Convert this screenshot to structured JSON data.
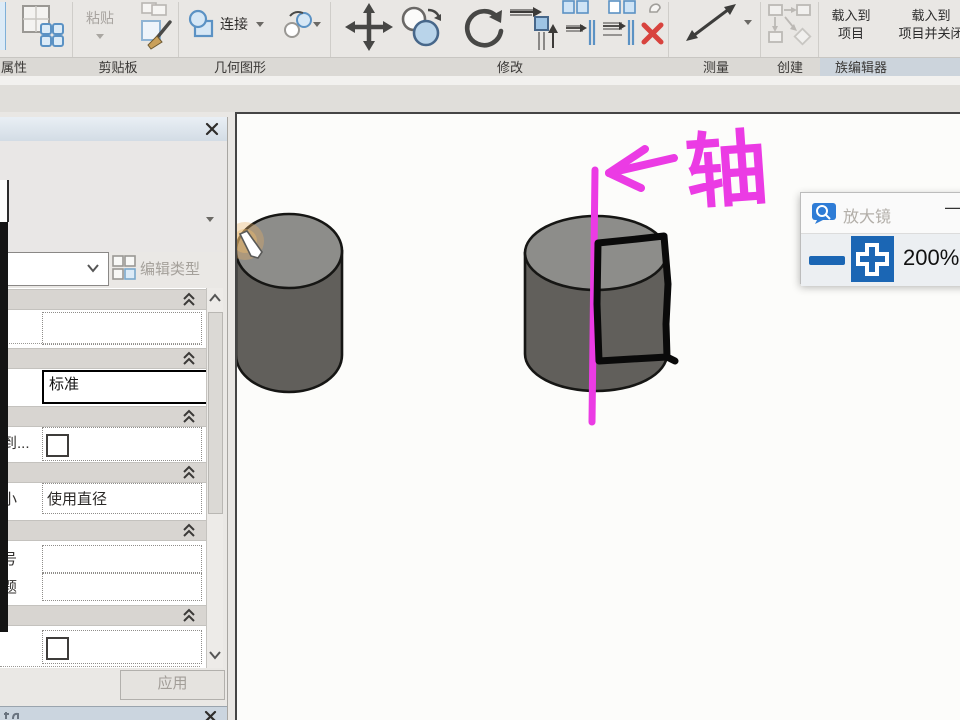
{
  "ribbon": {
    "sections": [
      {
        "label": "属性"
      },
      {
        "label": "剪贴板"
      },
      {
        "label": "几何图形"
      },
      {
        "label": "修改"
      },
      {
        "label": "测量"
      },
      {
        "label": "创建"
      },
      {
        "label": "族编辑器"
      }
    ],
    "paste": {
      "label": "粘贴"
    },
    "join": {
      "label": "连接"
    },
    "load_to_project": {
      "line1": "载入到",
      "line2": "项目"
    },
    "load_to_project_close": {
      "line1": "载入到",
      "line2": "项目并关闭"
    }
  },
  "properties_panel": {
    "edit_type_label": "编辑类型",
    "type_value": "标准",
    "rows": [
      {
        "label": "到...",
        "type": "checkbox"
      },
      {
        "label": "小",
        "value": "使用直径"
      },
      {
        "label": "号",
        "value": ""
      },
      {
        "label": "题",
        "value": ""
      }
    ],
    "apply_label": "应用"
  },
  "magnifier": {
    "title": "放大镜",
    "zoom_level": "200%",
    "minimize_glyph": "—"
  },
  "canvas": {
    "axis_annotation": "轴"
  },
  "colors": {
    "annotation_magenta": "#eb3be4",
    "magnifier_blue": "#1b66b4",
    "delete_red": "#d8433e",
    "cylinder_top": "#8d8d8a",
    "cylinder_side": "#615f5b"
  }
}
